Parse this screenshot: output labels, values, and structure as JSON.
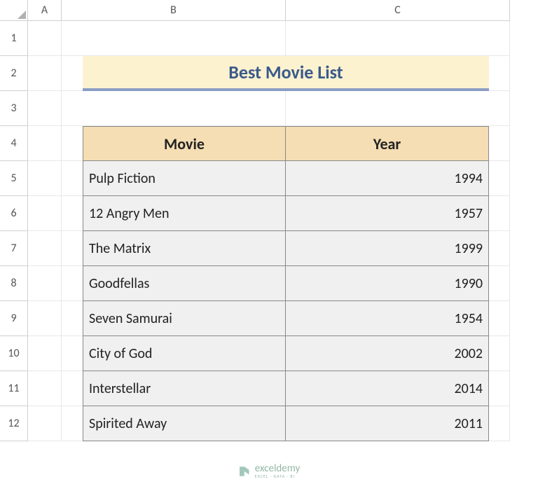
{
  "columns": [
    "A",
    "B",
    "C"
  ],
  "rows": [
    "1",
    "2",
    "3",
    "4",
    "5",
    "6",
    "7",
    "8",
    "9",
    "10",
    "11",
    "12"
  ],
  "title": "Best Movie List",
  "headers": {
    "movie": "Movie",
    "year": "Year"
  },
  "data": [
    {
      "movie": " Pulp  Fiction",
      "year": "1994"
    },
    {
      "movie": " 12 Angry Men",
      "year": "1957"
    },
    {
      "movie": "The Matrix",
      "year": "1999"
    },
    {
      "movie": " Goodfellas",
      "year": "1990"
    },
    {
      "movie": "Seven Samurai",
      "year": "1954"
    },
    {
      "movie": " City of God",
      "year": "2002"
    },
    {
      "movie": "Interstellar",
      "year": "2014"
    },
    {
      "movie": " Spirited Away",
      "year": "2011"
    }
  ],
  "watermark": {
    "brand": "exceldemy",
    "tagline": "EXCEL · DATA · BI"
  }
}
